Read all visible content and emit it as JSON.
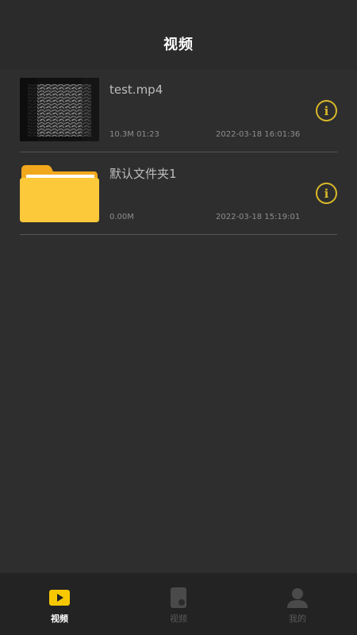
{
  "header": {
    "title": "视频"
  },
  "files": [
    {
      "name": "test.mp4",
      "meta": "10.3M  01:23",
      "date": "2022-03-18 16:01:36",
      "type": "video",
      "thumb_icon": "video-thumbnail"
    },
    {
      "name": "默认文件夹1",
      "meta": "0.00M",
      "date": "2022-03-18 15:19:01",
      "type": "folder",
      "thumb_icon": "folder-icon"
    }
  ],
  "tabs": [
    {
      "label": "视频",
      "icon": "play-icon",
      "active": true
    },
    {
      "label": "视频",
      "icon": "record-icon",
      "active": false
    },
    {
      "label": "我的",
      "icon": "person-icon",
      "active": false
    }
  ],
  "colors": {
    "accent": "#f7c800",
    "info": "#d9b82a",
    "background": "#2e2e2e",
    "tabbar": "#232323"
  }
}
